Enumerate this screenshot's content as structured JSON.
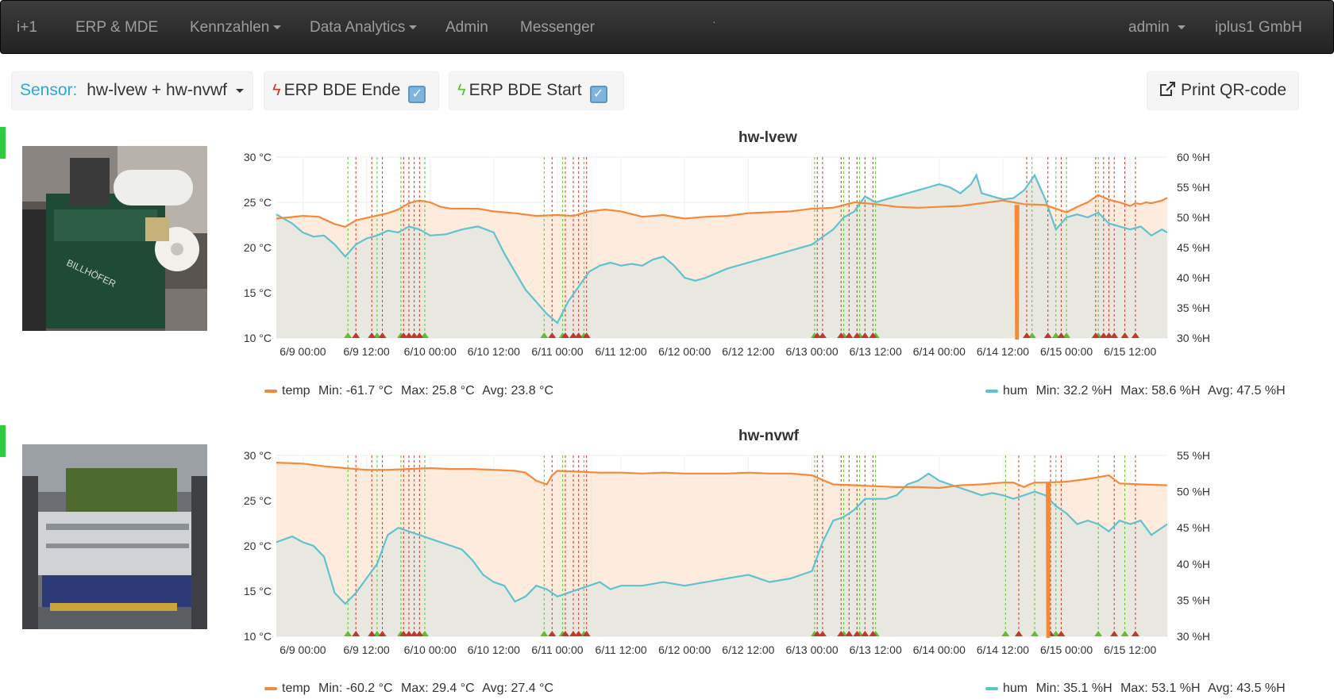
{
  "navbar": {
    "brand": "i+1",
    "items": [
      "ERP & MDE",
      "Kennzahlen",
      "Data Analytics",
      "Admin",
      "Messenger"
    ],
    "dot": "·",
    "user": "admin",
    "company": "iplus1 GmbH"
  },
  "toolbar": {
    "sensor_label": "Sensor:",
    "sensor_value": "hw-lvew + hw-nvwf",
    "erp_end": "ERP BDE Ende",
    "erp_start": "ERP BDE Start",
    "print_qr": "Print QR-code",
    "erp_end_checked": true,
    "erp_start_checked": true
  },
  "colors": {
    "temp": "#f5893a",
    "hum": "#5ec3cf",
    "temp_fill": "#fde6d6",
    "hum_fill": "#e5e8e0",
    "start_marker": "#5fbf2f",
    "end_marker": "#c0392b",
    "status": "#2ecc40"
  },
  "x_ticks": [
    "6/9 00:00",
    "6/9 12:00",
    "6/10 00:00",
    "6/10 12:00",
    "6/11 00:00",
    "6/11 12:00",
    "6/12 00:00",
    "6/12 12:00",
    "6/13 00:00",
    "6/13 12:00",
    "6/14 00:00",
    "6/14 12:00",
    "6/15 00:00",
    "6/15 12:00"
  ],
  "chart_data": [
    {
      "type": "line",
      "title": "hw-lvew",
      "x_unit": "hours since 6/9 00:00",
      "xlim": [
        -5,
        163
      ],
      "y_left": {
        "label": "°C",
        "ylim": [
          10,
          30
        ],
        "ticks": [
          "10 °C",
          "15 °C",
          "20 °C",
          "25 °C",
          "30 °C"
        ]
      },
      "y_right": {
        "label": "%H",
        "ylim": [
          30,
          60
        ],
        "ticks": [
          "30 %H",
          "35 %H",
          "40 %H",
          "45 %H",
          "50 %H",
          "55 %H",
          "60 %H"
        ]
      },
      "series": [
        {
          "name": "temp",
          "axis": "left",
          "x": [
            -5,
            0,
            3,
            6,
            8,
            10,
            13,
            16,
            18,
            20,
            22,
            24,
            26,
            28,
            30,
            33,
            36,
            40,
            44,
            48,
            51,
            54,
            57,
            60,
            64,
            68,
            72,
            76,
            80,
            84,
            88,
            92,
            96,
            100,
            104,
            108,
            112,
            116,
            120,
            124,
            128,
            132,
            136,
            140,
            144,
            146,
            148,
            150,
            152,
            154,
            156,
            157,
            158,
            159,
            160,
            162,
            163
          ],
          "values": [
            23.2,
            23.5,
            23.4,
            22.6,
            22.3,
            23.0,
            23.4,
            23.8,
            24.2,
            24.9,
            25.2,
            25.0,
            24.5,
            24.3,
            24.3,
            24.3,
            24.0,
            23.8,
            23.5,
            23.6,
            23.5,
            24.0,
            24.2,
            24.0,
            23.4,
            23.6,
            23.2,
            23.4,
            23.5,
            23.8,
            23.9,
            24.0,
            24.3,
            24.4,
            25.0,
            24.8,
            24.5,
            24.4,
            24.5,
            24.6,
            24.9,
            25.2,
            24.8,
            24.7,
            23.9,
            24.5,
            25.0,
            25.8,
            25.3,
            25.0,
            24.6,
            24.9,
            24.8,
            25.0,
            24.9,
            25.2,
            25.5
          ]
        },
        {
          "name": "temp_drop",
          "axis": "left",
          "x": [
            134.5,
            134.6,
            134.7,
            134.8
          ],
          "values": [
            24.7,
            10.0,
            10.0,
            24.7
          ]
        },
        {
          "name": "hum",
          "axis": "right",
          "x": [
            -5,
            -2,
            0,
            2,
            4,
            6,
            8,
            10,
            12,
            14,
            16,
            18,
            20,
            22,
            24,
            27,
            30,
            33,
            36,
            38,
            40,
            42,
            44,
            46,
            48,
            50,
            52,
            54,
            56,
            58,
            60,
            62,
            64,
            66,
            68,
            70,
            72,
            74,
            76,
            80,
            84,
            88,
            92,
            96,
            100,
            102,
            104,
            106,
            108,
            110,
            112,
            114,
            116,
            118,
            120,
            122,
            124,
            126,
            127,
            128,
            130,
            132,
            134,
            136,
            138,
            140,
            142,
            144,
            146,
            148,
            150,
            152,
            154,
            156,
            158,
            160,
            162,
            163
          ],
          "values": [
            50.5,
            49.0,
            47.5,
            46.8,
            47.0,
            45.5,
            43.5,
            45.5,
            46.5,
            47.0,
            47.8,
            47.5,
            48.5,
            48.0,
            47.0,
            47.2,
            48.0,
            48.5,
            47.5,
            44.0,
            41.0,
            38.0,
            36.0,
            34.0,
            32.5,
            36.0,
            38.5,
            41.0,
            42.0,
            42.5,
            42.0,
            42.3,
            42.0,
            43.0,
            43.5,
            42.0,
            40.0,
            39.5,
            40.0,
            41.5,
            42.5,
            43.5,
            44.5,
            45.5,
            48.0,
            50.0,
            51.0,
            53.5,
            52.5,
            53.0,
            53.5,
            54.0,
            54.5,
            55.0,
            55.5,
            55.0,
            54.0,
            55.5,
            57.0,
            54.0,
            53.5,
            53.0,
            53.2,
            54.5,
            57.0,
            53.0,
            48.0,
            50.0,
            50.5,
            50.0,
            50.8,
            49.0,
            48.5,
            48.0,
            48.5,
            47.0,
            48.0,
            47.5
          ]
        }
      ],
      "erp_markers": {
        "start": [
          8.5,
          14,
          18.5,
          23,
          45.5,
          49,
          53,
          96.5,
          102,
          105,
          108,
          137.5,
          142,
          144,
          150
        ],
        "end": [
          10,
          13,
          15,
          19,
          20,
          21,
          22,
          47,
          49.5,
          51,
          52,
          53.5,
          97,
          98,
          101.5,
          103,
          104.5,
          106,
          107.5,
          136.5,
          140.5,
          143,
          149.5,
          151,
          152,
          153,
          155,
          157
        ]
      },
      "legend": {
        "temp": {
          "name": "temp",
          "min_label": "Min:",
          "min": "-61.7 °C",
          "max_label": "Max:",
          "max": "25.8 °C",
          "avg_label": "Avg:",
          "avg": "23.8 °C"
        },
        "hum": {
          "name": "hum",
          "min_label": "Min:",
          "min": "32.2 %H",
          "max_label": "Max:",
          "max": "58.6 %H",
          "avg_label": "Avg:",
          "avg": "47.5 %H"
        }
      }
    },
    {
      "type": "line",
      "title": "hw-nvwf",
      "x_unit": "hours since 6/9 00:00",
      "xlim": [
        -5,
        163
      ],
      "y_left": {
        "label": "°C",
        "ylim": [
          10,
          30
        ],
        "ticks": [
          "10 °C",
          "15 °C",
          "20 °C",
          "25 °C",
          "30 °C"
        ]
      },
      "y_right": {
        "label": "%H",
        "ylim": [
          30,
          55
        ],
        "ticks": [
          "30 %H",
          "35 %H",
          "40 %H",
          "45 %H",
          "50 %H",
          "55 %H"
        ]
      },
      "series": [
        {
          "name": "temp",
          "axis": "left",
          "x": [
            -5,
            0,
            4,
            8,
            12,
            16,
            20,
            24,
            28,
            32,
            36,
            40,
            42,
            44,
            46,
            47,
            48,
            52,
            56,
            60,
            64,
            68,
            72,
            76,
            80,
            84,
            88,
            92,
            96,
            100,
            104,
            108,
            112,
            116,
            120,
            124,
            128,
            130,
            132,
            134,
            136,
            137,
            138,
            140,
            144,
            148,
            150,
            152,
            154,
            158,
            163
          ],
          "values": [
            29.2,
            29.1,
            28.8,
            28.6,
            28.4,
            28.4,
            28.5,
            28.6,
            28.5,
            28.5,
            28.4,
            28.3,
            28.1,
            27.2,
            26.8,
            27.8,
            28.3,
            28.2,
            28.1,
            28.1,
            28.0,
            28.1,
            28.0,
            28.0,
            28.0,
            28.1,
            28.0,
            28.0,
            27.8,
            26.8,
            26.7,
            26.6,
            26.5,
            26.5,
            26.4,
            26.7,
            26.8,
            26.9,
            27.0,
            27.0,
            26.5,
            26.8,
            27.0,
            27.0,
            27.1,
            27.4,
            27.6,
            27.8,
            26.9,
            26.8,
            26.7
          ]
        },
        {
          "name": "temp_drop",
          "axis": "left",
          "x": [
            140.4,
            140.5,
            140.6,
            140.7
          ],
          "values": [
            27.0,
            10.0,
            10.0,
            27.0
          ]
        },
        {
          "name": "hum",
          "axis": "right",
          "x": [
            -5,
            -2,
            0,
            2,
            4,
            6,
            8,
            10,
            12,
            14,
            16,
            18,
            20,
            22,
            24,
            26,
            28,
            30,
            32,
            34,
            36,
            38,
            40,
            42,
            44,
            46,
            48,
            50,
            52,
            54,
            56,
            58,
            60,
            64,
            68,
            72,
            76,
            80,
            84,
            88,
            92,
            96,
            98,
            100,
            102,
            104,
            106,
            108,
            110,
            112,
            114,
            116,
            118,
            120,
            122,
            124,
            126,
            128,
            130,
            132,
            134,
            136,
            138,
            140,
            142,
            144,
            146,
            148,
            150,
            152,
            154,
            156,
            158,
            160,
            163
          ],
          "values": [
            43.0,
            43.8,
            43.0,
            42.5,
            41.0,
            36.0,
            34.5,
            36.0,
            38.0,
            40.0,
            44.0,
            45.0,
            44.5,
            44.0,
            43.5,
            43.0,
            42.5,
            42.0,
            40.5,
            38.5,
            37.5,
            37.0,
            34.8,
            35.5,
            37.0,
            36.5,
            35.5,
            36.0,
            36.5,
            37.0,
            37.5,
            36.5,
            37.0,
            37.0,
            37.5,
            37.0,
            37.5,
            38.0,
            38.5,
            37.5,
            38.0,
            39.0,
            43.0,
            46.0,
            46.5,
            47.5,
            49.0,
            49.0,
            49.0,
            49.5,
            51.0,
            51.5,
            52.5,
            51.5,
            51.0,
            50.5,
            50.0,
            49.5,
            49.8,
            49.5,
            49.0,
            49.5,
            50.0,
            49.5,
            48.0,
            47.0,
            45.5,
            46.0,
            45.5,
            44.5,
            46.0,
            45.5,
            46.0,
            44.0,
            45.5
          ]
        }
      ],
      "erp_markers": {
        "start": [
          8.5,
          14,
          18.5,
          23,
          45.5,
          49,
          53,
          96.5,
          102,
          105,
          108,
          132.5,
          138,
          142,
          150,
          155
        ],
        "end": [
          10,
          13,
          15,
          19,
          20,
          21,
          22,
          47,
          49.5,
          51,
          52,
          53.5,
          97,
          98,
          101.5,
          103,
          104.5,
          106,
          107.5,
          135,
          141,
          143,
          153,
          157
        ]
      },
      "legend": {
        "temp": {
          "name": "temp",
          "min_label": "Min:",
          "min": "-60.2 °C",
          "max_label": "Max:",
          "max": "29.4 °C",
          "avg_label": "Avg:",
          "avg": "27.4 °C"
        },
        "hum": {
          "name": "hum",
          "min_label": "Min:",
          "min": "35.1 %H",
          "max_label": "Max:",
          "max": "53.1 %H",
          "avg_label": "Avg:",
          "avg": "43.5 %H"
        }
      }
    }
  ]
}
